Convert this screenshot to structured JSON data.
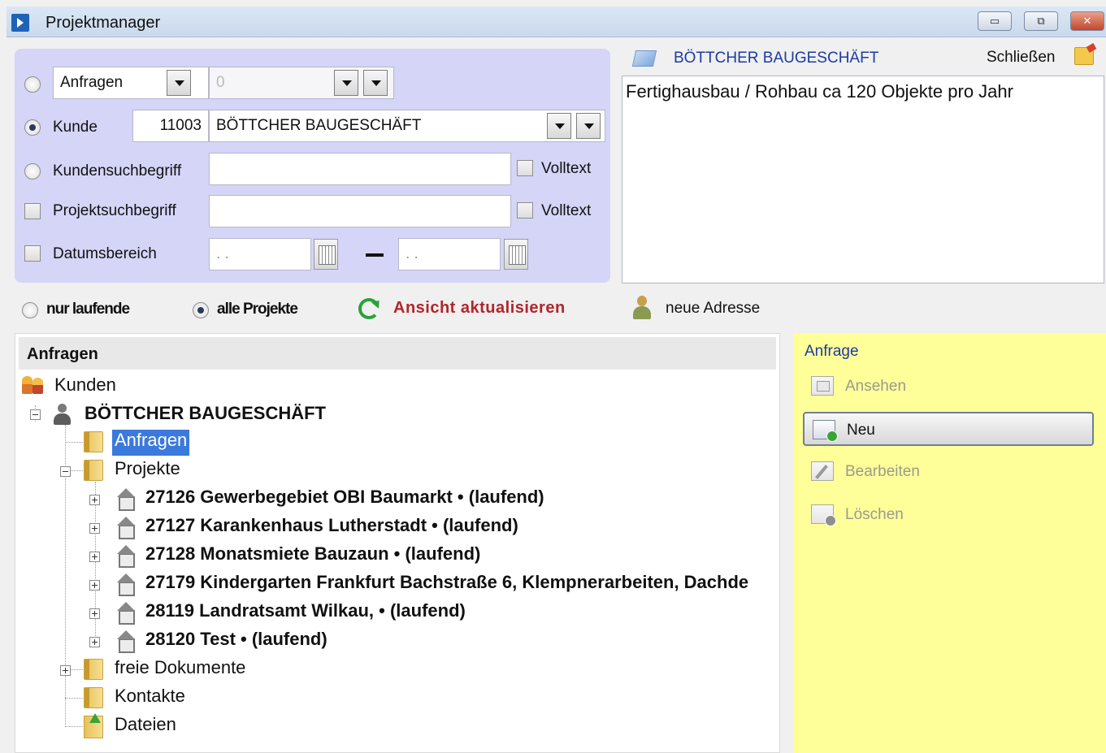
{
  "window": {
    "title": "Projektmanager",
    "buttons": {
      "minimize": "▭",
      "restore": "⧉",
      "close": "✕"
    }
  },
  "search": {
    "rows": {
      "anfragen": {
        "select_value": "Anfragen",
        "second_value": "0"
      },
      "kunde": {
        "label": "Kunde",
        "number": "11003",
        "name": "BÖTTCHER BAUGESCHÄFT"
      },
      "kundensuchbegriff": {
        "label": "Kundensuchbegriff",
        "value": "",
        "volltext": "Volltext"
      },
      "projektsuchbegriff": {
        "label": "Projektsuchbegriff",
        "value": "",
        "volltext": "Volltext"
      },
      "datumsbereich": {
        "label": "Datumsbereich",
        "from": ". .",
        "to": ". ."
      }
    }
  },
  "info": {
    "company": "BÖTTCHER BAUGESCHÄFT",
    "close_label": "Schließen",
    "notes": "Fertighausbau / Rohbau ca 120 Objekte pro Jahr"
  },
  "options": {
    "nur_laufende": "nur laufende",
    "alle_projekte": "alle Projekte",
    "refresh": "Ansicht aktualisieren",
    "new_address": "neue Adresse"
  },
  "tree": {
    "header": "Anfragen",
    "root": "Kunden",
    "customer": "BÖTTCHER BAUGESCHÄFT",
    "folders": {
      "anfragen": "Anfragen",
      "projekte": "Projekte",
      "freie_dokumente": "freie Dokumente",
      "kontakte": "Kontakte",
      "dateien": "Dateien"
    },
    "projects": [
      "27126 Gewerbegebiet OBI Baumarkt • (laufend)",
      "27127 Karankenhaus Lutherstadt • (laufend)",
      "27128 Monatsmiete Bauzaun • (laufend)",
      "27179 Kindergarten Frankfurt Bachstraße 6, Klempnerarbeiten, Dachde",
      "28119 Landratsamt Wilkau, • (laufend)",
      "28120 Test • (laufend)"
    ]
  },
  "actions": {
    "title": "Anfrage",
    "items": [
      "Ansehen",
      "Neu",
      "Bearbeiten",
      "Löschen"
    ]
  },
  "colors": {
    "search_panel_bg": "#d4d5f7",
    "action_panel_bg": "#ffff99",
    "refresh_text": "#b2252a",
    "link_blue": "#1c3aa5",
    "selection": "#3b79dc"
  }
}
